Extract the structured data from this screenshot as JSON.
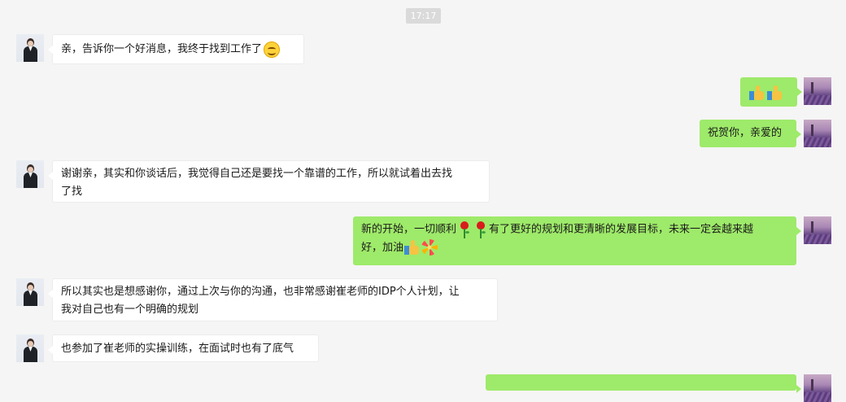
{
  "chat": {
    "timestamp": "17:17",
    "messages": [
      {
        "side": "left",
        "text": "亲，告诉你一个好消息，我终于找到工作了",
        "emoji": "smile-icon"
      },
      {
        "side": "right",
        "text": "",
        "emoji": "thumbs-up-icon x2"
      },
      {
        "side": "right",
        "text": "祝贺你，亲爱的"
      },
      {
        "side": "left",
        "line1": "谢谢亲，其实和你谈话后，我觉得自己还是要找一个靠谱的工作，所以就试着出去找",
        "line2": "了找"
      },
      {
        "side": "right",
        "part1": "新的开始，一切顺利",
        "part2": "有了更好的规划和更清晰的发展目标，未来一定会越来越",
        "line2": "好，加油"
      },
      {
        "side": "left",
        "line1": "所以其实也是想感谢你，通过上次与你的沟通，也非常感谢崔老师的IDP个人计划，让",
        "line2": "我对自己也有一个明确的规划"
      },
      {
        "side": "left",
        "text": "也参加了崔老师的实操训练，在面试时也有了底气"
      }
    ]
  },
  "colors": {
    "background": "#f5f5f5",
    "left_bubble": "#ffffff",
    "right_bubble": "#9eea6a",
    "timestamp_bg": "#dadada"
  }
}
